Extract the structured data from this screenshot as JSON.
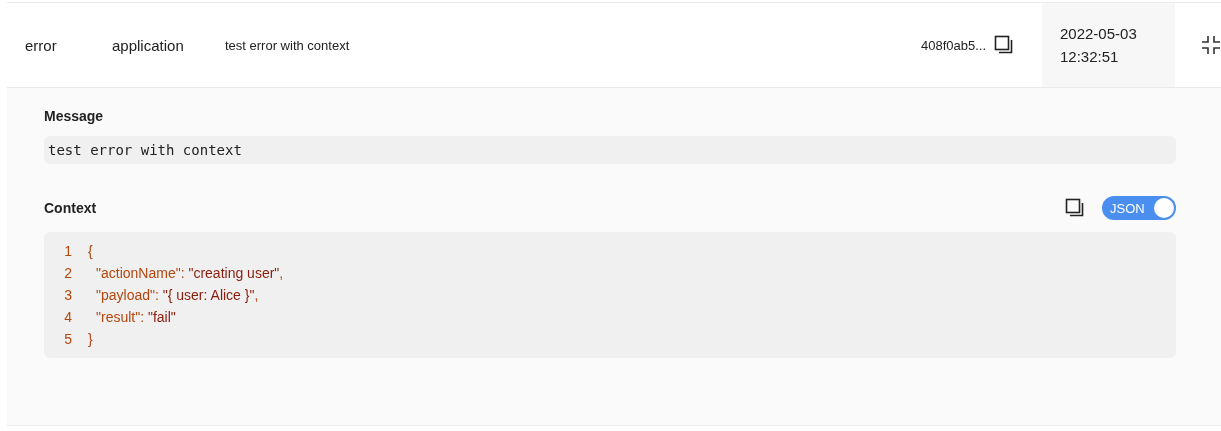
{
  "row": {
    "level": "error",
    "source": "application",
    "message": "test error with context",
    "id": "408f0ab5...",
    "date": "2022-05-03",
    "time": "12:32:51",
    "expanded": true
  },
  "details": {
    "message_label": "Message",
    "message": "test error with context",
    "context_label": "Context",
    "json_toggle": {
      "label": "JSON",
      "on": true
    },
    "code_lines": [
      {
        "number": "1",
        "indent": false,
        "tokens": [
          {
            "kind": "punct",
            "text": "{"
          }
        ]
      },
      {
        "number": "2",
        "indent": true,
        "tokens": [
          {
            "kind": "key",
            "text": "\"actionName\""
          },
          {
            "kind": "punct",
            "text": ": "
          },
          {
            "kind": "value",
            "text": "\"creating user\""
          },
          {
            "kind": "punct",
            "text": ","
          }
        ]
      },
      {
        "number": "3",
        "indent": true,
        "tokens": [
          {
            "kind": "key",
            "text": "\"payload\""
          },
          {
            "kind": "punct",
            "text": ": "
          },
          {
            "kind": "value",
            "text": "\"{ user: Alice }\""
          },
          {
            "kind": "punct",
            "text": ","
          }
        ]
      },
      {
        "number": "4",
        "indent": true,
        "tokens": [
          {
            "kind": "key",
            "text": "\"result\""
          },
          {
            "kind": "punct",
            "text": ": "
          },
          {
            "kind": "value",
            "text": "\"fail\""
          }
        ]
      },
      {
        "number": "5",
        "indent": false,
        "tokens": [
          {
            "kind": "punct",
            "text": "}"
          }
        ]
      }
    ]
  }
}
